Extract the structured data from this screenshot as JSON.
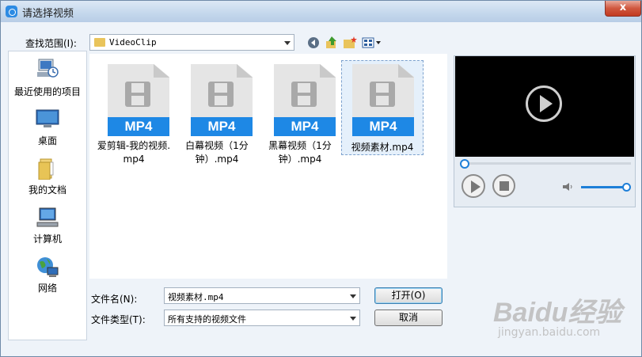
{
  "window": {
    "title": "请选择视频",
    "close_glyph": "x"
  },
  "toolbar": {
    "look_in_label": "查找范围(I):",
    "current_folder": "VideoClip",
    "icons": [
      "back-icon",
      "up-folder-icon",
      "new-folder-icon",
      "view-menu-icon"
    ]
  },
  "places": [
    {
      "label": "最近使用的项目",
      "icon": "recent-items-icon"
    },
    {
      "label": "桌面",
      "icon": "desktop-icon"
    },
    {
      "label": "我的文档",
      "icon": "my-documents-icon"
    },
    {
      "label": "计算机",
      "icon": "computer-icon"
    },
    {
      "label": "网络",
      "icon": "network-icon"
    }
  ],
  "files": [
    {
      "badge": "MP4",
      "line1": "爱剪辑-我的视频.",
      "line2": "mp4",
      "selected": false
    },
    {
      "badge": "MP4",
      "line1": "白幕视频（1分",
      "line2": "钟）.mp4",
      "selected": false
    },
    {
      "badge": "MP4",
      "line1": "黑幕视频（1分",
      "line2": "钟）.mp4",
      "selected": false
    },
    {
      "badge": "MP4",
      "line1": "视频素材.mp4",
      "line2": "",
      "selected": true
    }
  ],
  "form": {
    "filename_label": "文件名(N):",
    "filename_value": "视频素材.mp4",
    "filetype_label": "文件类型(T):",
    "filetype_value": "所有支持的视频文件",
    "open_button": "打开(O)",
    "cancel_button": "取消"
  },
  "player": {
    "progress": 0.0,
    "volume": 1.0
  },
  "watermark": {
    "main": "Baidu经验",
    "sub": "jingyan.baidu.com"
  },
  "colors": {
    "accent": "#1e88e5",
    "title_bar": "#c4d7ec",
    "close": "#c23a20"
  }
}
